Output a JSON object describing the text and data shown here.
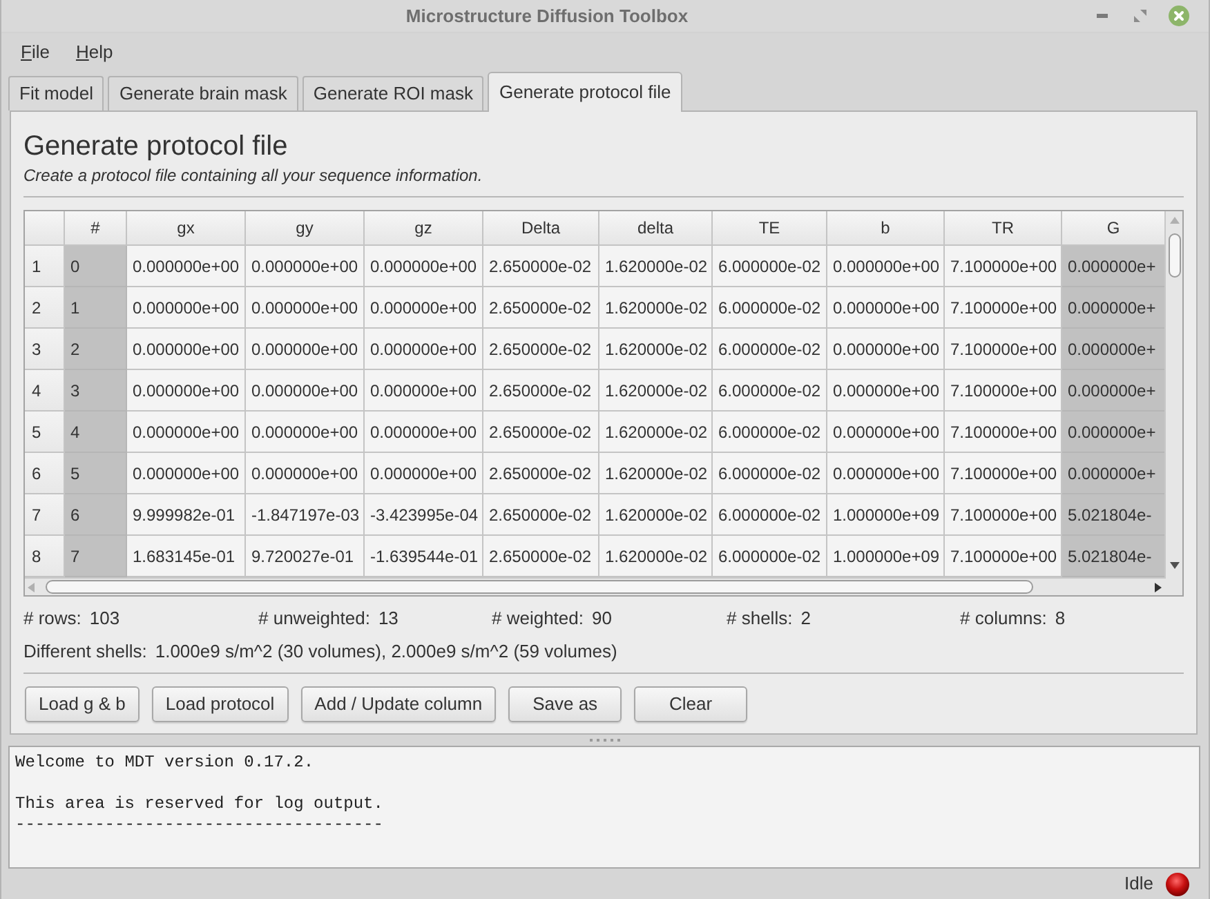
{
  "window": {
    "title": "Microstructure Diffusion Toolbox"
  },
  "menu": [
    "File",
    "Help"
  ],
  "tabs": [
    {
      "label": "Fit model",
      "selected": false
    },
    {
      "label": "Generate brain mask",
      "selected": false
    },
    {
      "label": "Generate ROI mask",
      "selected": false
    },
    {
      "label": "Generate protocol file",
      "selected": true
    }
  ],
  "panel": {
    "heading": "Generate protocol file",
    "subtitle": "Create a protocol file containing all your sequence information.",
    "table": {
      "columns": [
        {
          "label": "#",
          "shaded": true
        },
        {
          "label": "gx",
          "shaded": false
        },
        {
          "label": "gy",
          "shaded": false
        },
        {
          "label": "gz",
          "shaded": false
        },
        {
          "label": "Delta",
          "shaded": false
        },
        {
          "label": "delta",
          "shaded": false
        },
        {
          "label": "TE",
          "shaded": false
        },
        {
          "label": "b",
          "shaded": false
        },
        {
          "label": "TR",
          "shaded": false
        },
        {
          "label": "G",
          "shaded": true
        }
      ],
      "rows": [
        {
          "header": "1",
          "cells": [
            "0",
            "0.000000e+00",
            "0.000000e+00",
            "0.000000e+00",
            "2.650000e-02",
            "1.620000e-02",
            "6.000000e-02",
            "0.000000e+00",
            "7.100000e+00",
            "0.000000e+"
          ]
        },
        {
          "header": "2",
          "cells": [
            "1",
            "0.000000e+00",
            "0.000000e+00",
            "0.000000e+00",
            "2.650000e-02",
            "1.620000e-02",
            "6.000000e-02",
            "0.000000e+00",
            "7.100000e+00",
            "0.000000e+"
          ]
        },
        {
          "header": "3",
          "cells": [
            "2",
            "0.000000e+00",
            "0.000000e+00",
            "0.000000e+00",
            "2.650000e-02",
            "1.620000e-02",
            "6.000000e-02",
            "0.000000e+00",
            "7.100000e+00",
            "0.000000e+"
          ]
        },
        {
          "header": "4",
          "cells": [
            "3",
            "0.000000e+00",
            "0.000000e+00",
            "0.000000e+00",
            "2.650000e-02",
            "1.620000e-02",
            "6.000000e-02",
            "0.000000e+00",
            "7.100000e+00",
            "0.000000e+"
          ]
        },
        {
          "header": "5",
          "cells": [
            "4",
            "0.000000e+00",
            "0.000000e+00",
            "0.000000e+00",
            "2.650000e-02",
            "1.620000e-02",
            "6.000000e-02",
            "0.000000e+00",
            "7.100000e+00",
            "0.000000e+"
          ]
        },
        {
          "header": "6",
          "cells": [
            "5",
            "0.000000e+00",
            "0.000000e+00",
            "0.000000e+00",
            "2.650000e-02",
            "1.620000e-02",
            "6.000000e-02",
            "0.000000e+00",
            "7.100000e+00",
            "0.000000e+"
          ]
        },
        {
          "header": "7",
          "cells": [
            "6",
            "9.999982e-01",
            "-1.847197e-03",
            "-3.423995e-04",
            "2.650000e-02",
            "1.620000e-02",
            "6.000000e-02",
            "1.000000e+09",
            "7.100000e+00",
            "5.021804e-"
          ]
        },
        {
          "header": "8",
          "cells": [
            "7",
            "1.683145e-01",
            "9.720027e-01",
            "-1.639544e-01",
            "2.650000e-02",
            "1.620000e-02",
            "6.000000e-02",
            "1.000000e+09",
            "7.100000e+00",
            "5.021804e-"
          ]
        }
      ]
    },
    "stats": [
      {
        "label": "# rows:",
        "value": "103"
      },
      {
        "label": "# unweighted:",
        "value": "13"
      },
      {
        "label": "# weighted:",
        "value": "90"
      },
      {
        "label": "# shells:",
        "value": "2"
      },
      {
        "label": "# columns:",
        "value": "8"
      }
    ],
    "shells": {
      "label": "Different shells:",
      "value": "1.000e9 s/m^2 (30 volumes), 2.000e9 s/m^2 (59 volumes)"
    },
    "buttons": [
      "Load g & b",
      "Load protocol",
      "Add / Update column",
      "Save as",
      "Clear"
    ]
  },
  "log": {
    "text": "Welcome to MDT version 0.17.2.\n\nThis area is reserved for log output.\n-------------------------------------"
  },
  "status_bar": {
    "text": "Idle"
  }
}
